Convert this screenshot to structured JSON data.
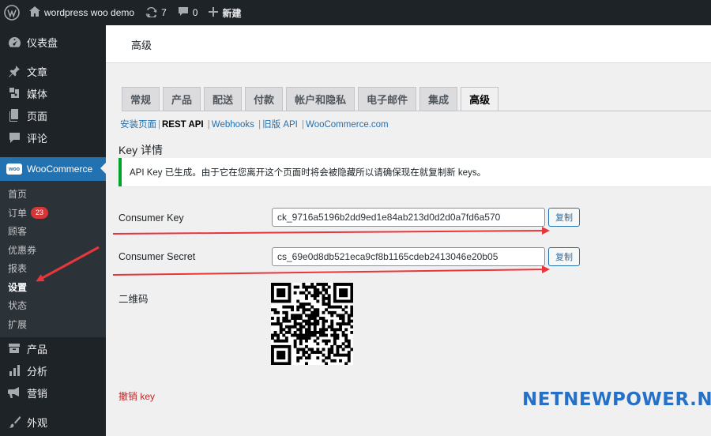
{
  "adminbar": {
    "site_name": "wordpress woo demo",
    "updates_count": "7",
    "comments_count": "0",
    "new_label": "新建"
  },
  "sidebar": {
    "items_top": [
      {
        "label": "仪表盘",
        "icon": "dashboard-icon"
      },
      {
        "label": "文章",
        "icon": "pin-icon"
      },
      {
        "label": "媒体",
        "icon": "media-icon"
      },
      {
        "label": "页面",
        "icon": "page-icon"
      },
      {
        "label": "评论",
        "icon": "comment-icon"
      }
    ],
    "woocommerce": {
      "label": "WooCommerce",
      "icon_text": "woo"
    },
    "submenu": [
      {
        "label": "首页"
      },
      {
        "label": "订单",
        "badge": "23"
      },
      {
        "label": "顾客"
      },
      {
        "label": "优惠券"
      },
      {
        "label": "报表"
      },
      {
        "label": "设置"
      },
      {
        "label": "状态"
      },
      {
        "label": "扩展"
      }
    ],
    "items_bottom": [
      {
        "label": "产品",
        "icon": "product-icon"
      },
      {
        "label": "分析",
        "icon": "analytics-icon"
      },
      {
        "label": "营销",
        "icon": "megaphone-icon"
      },
      {
        "label": "外观",
        "icon": "brush-icon"
      }
    ]
  },
  "header": {
    "title": "高级"
  },
  "tabs": [
    "常规",
    "产品",
    "配送",
    "付款",
    "帐户和隐私",
    "电子邮件",
    "集成",
    "高级"
  ],
  "subnav": [
    {
      "label": "安装页面"
    },
    {
      "label": "REST API"
    },
    {
      "label": "Webhooks"
    },
    {
      "label": "旧版 API"
    },
    {
      "label": "WooCommerce.com"
    }
  ],
  "key_details": {
    "title": "Key 详情",
    "notice": "API Key 已生成。由于它在您离开这个页面时将会被隐藏所以请确保现在就复制新 keys。",
    "consumer_key_label": "Consumer Key",
    "consumer_key_value": "ck_9716a5196b2dd9ed1e84ab213d0d2d0a7fd6a570",
    "consumer_secret_label": "Consumer Secret",
    "consumer_secret_value": "cs_69e0d8db521eca9cf8b1165cdeb2413046e20b05",
    "copy_label": "复制",
    "qr_label": "二维码",
    "revoke_label": "撤销 key"
  },
  "watermark": "NETNEWPOWER.NET",
  "colors": {
    "accent": "#2271b1",
    "admin_dark": "#1d2327",
    "arrow": "#e8363a",
    "success": "#00a32a"
  }
}
